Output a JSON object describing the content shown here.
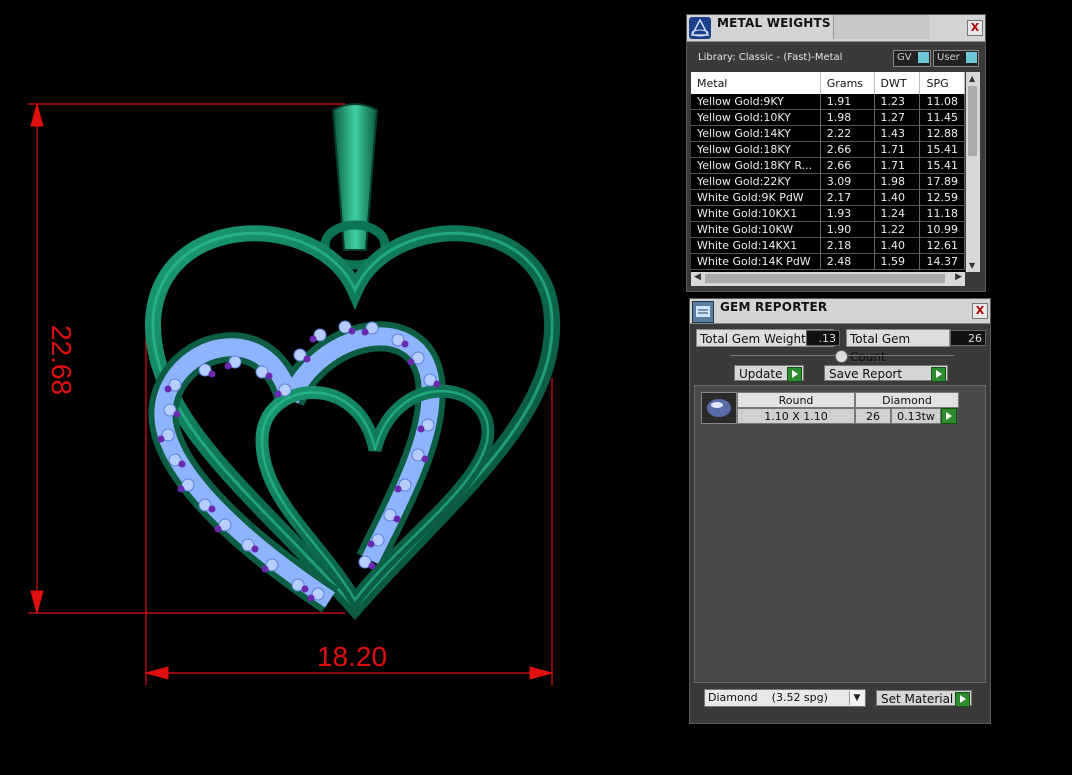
{
  "viewport": {
    "dim_height": "22.68",
    "dim_width": "18.20"
  },
  "metal_weights": {
    "title": "METAL WEIGHTS",
    "close": "X",
    "library": "Library: Classic - (Fast)-Metal",
    "toggle_gv": "GV",
    "toggle_user": "User",
    "columns": [
      "Metal",
      "Grams",
      "DWT",
      "SPG"
    ],
    "rows": [
      [
        "Yellow Gold:9KY",
        "1.91",
        "1.23",
        "11.08"
      ],
      [
        "Yellow Gold:10KY",
        "1.98",
        "1.27",
        "11.45"
      ],
      [
        "Yellow Gold:14KY",
        "2.22",
        "1.43",
        "12.88"
      ],
      [
        "Yellow Gold:18KY",
        "2.66",
        "1.71",
        "15.41"
      ],
      [
        "Yellow Gold:18KY R...",
        "2.66",
        "1.71",
        "15.41"
      ],
      [
        "Yellow Gold:22KY",
        "3.09",
        "1.98",
        "17.89"
      ],
      [
        "White Gold:9K PdW",
        "2.17",
        "1.40",
        "12.59"
      ],
      [
        "White Gold:10KX1",
        "1.93",
        "1.24",
        "11.18"
      ],
      [
        "White Gold:10KW",
        "1.90",
        "1.22",
        "10.99"
      ],
      [
        "White Gold:14KX1",
        "2.18",
        "1.40",
        "12.61"
      ],
      [
        "White Gold:14K PdW",
        "2.48",
        "1.59",
        "14.37"
      ]
    ]
  },
  "gem_reporter": {
    "title": "GEM REPORTER",
    "close": "X",
    "total_weight_label": "Total Gem Weight",
    "total_weight_value": ".13",
    "total_count_label": "Total Gem Count",
    "total_count_value": "26",
    "update_label": "Update",
    "save_report_label": "Save Report",
    "gem_row": {
      "cut": "Round",
      "size": "1.10 X 1.10",
      "material": "Diamond",
      "count": "26",
      "weight": "0.13tw"
    },
    "material_select": "Diamond    (3.52 spg)",
    "set_material_label": "Set Material"
  },
  "colors": {
    "dimension": "#e01010",
    "metal": "#0f7a5a",
    "gem": "#8fb4ff",
    "prong": "#6a2ab0"
  }
}
